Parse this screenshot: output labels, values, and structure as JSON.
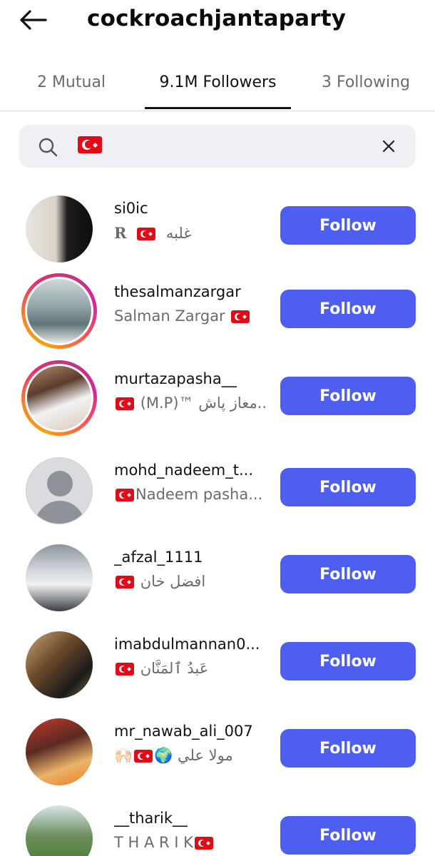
{
  "header": {
    "title": "cockroachjantaparty"
  },
  "tabs": [
    {
      "label": "2 Mutual"
    },
    {
      "label": "9.1M Followers"
    },
    {
      "label": "3 Following"
    }
  ],
  "search": {
    "query_flag": "turkey-flag-icon"
  },
  "follow_label": "Follow",
  "followers": [
    {
      "username": "si0ic",
      "subtitle_prefix": "R",
      "subtitle_suffix": "غلبه"
    },
    {
      "username": "thesalmanzargar",
      "subtitle_prefix": "Salman Zargar",
      "subtitle_suffix": ""
    },
    {
      "username": "murtazapasha__",
      "subtitle_prefix": "",
      "subtitle_suffix": "(M.P)™ معاز پاش..."
    },
    {
      "username": "mohd_nadeem_t...",
      "subtitle_prefix": "",
      "subtitle_suffix": "Nadeem pasha..."
    },
    {
      "username": "_afzal_1111",
      "subtitle_prefix": "",
      "subtitle_suffix": "افضل خان"
    },
    {
      "username": "imabdulmannan0...",
      "subtitle_prefix": "",
      "subtitle_suffix": "عَبدُ ٱلمَنَّان"
    },
    {
      "username": "mr_nawab_ali_007",
      "subtitle_prefix": "🙌🏻",
      "subtitle_suffix": "🌍 مولا علي"
    },
    {
      "username": "__tharik__",
      "subtitle_prefix": "T H A R I K",
      "subtitle_suffix": ""
    }
  ],
  "colors": {
    "follow_button": "#4e5ef0",
    "flag_red": "#e30a17"
  }
}
